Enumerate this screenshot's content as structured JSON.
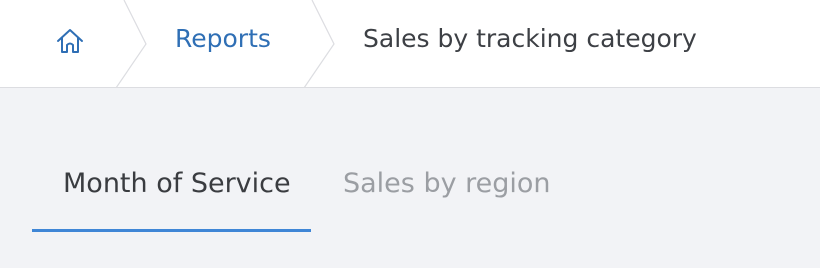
{
  "breadcrumb": {
    "home_icon": "home-icon",
    "items": [
      {
        "label": "Reports"
      },
      {
        "label": "Sales by tracking category"
      }
    ]
  },
  "tabs": [
    {
      "label": "Month of Service",
      "active": true
    },
    {
      "label": "Sales by region",
      "active": false
    }
  ],
  "colors": {
    "link": "#2f6fb5",
    "active_tab_underline": "#3f86d6",
    "inactive_tab": "#9b9ea3"
  }
}
